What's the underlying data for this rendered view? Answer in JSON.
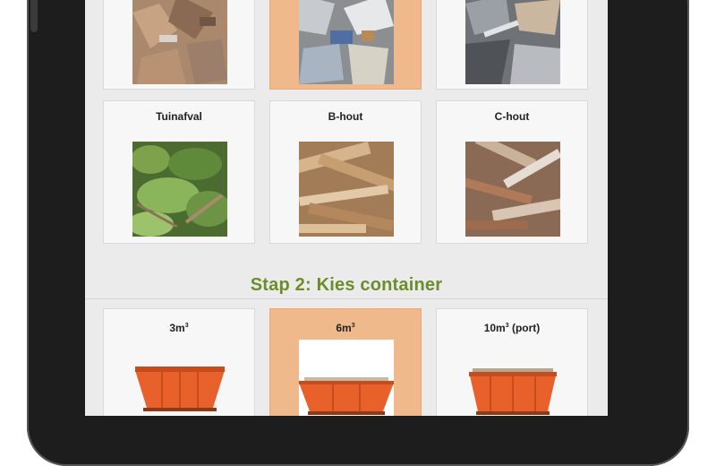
{
  "waste_types": [
    {
      "label": "",
      "selected": false
    },
    {
      "label": "",
      "selected": true
    },
    {
      "label": "",
      "selected": false
    },
    {
      "label": "Tuinafval",
      "selected": false
    },
    {
      "label": "B-hout",
      "selected": false
    },
    {
      "label": "C-hout",
      "selected": false
    }
  ],
  "step2": {
    "title": "Stap 2: Kies container"
  },
  "containers": [
    {
      "size": "3m",
      "sup": "3",
      "suffix": "",
      "selected": false
    },
    {
      "size": "6m",
      "sup": "3",
      "suffix": "",
      "selected": true
    },
    {
      "size": "10m",
      "sup": "3",
      "suffix": " (port)",
      "selected": false
    }
  ],
  "colors": {
    "accent_green": "#6b8e2b",
    "selected": "#f0b98c",
    "container_orange": "#e8602a"
  }
}
